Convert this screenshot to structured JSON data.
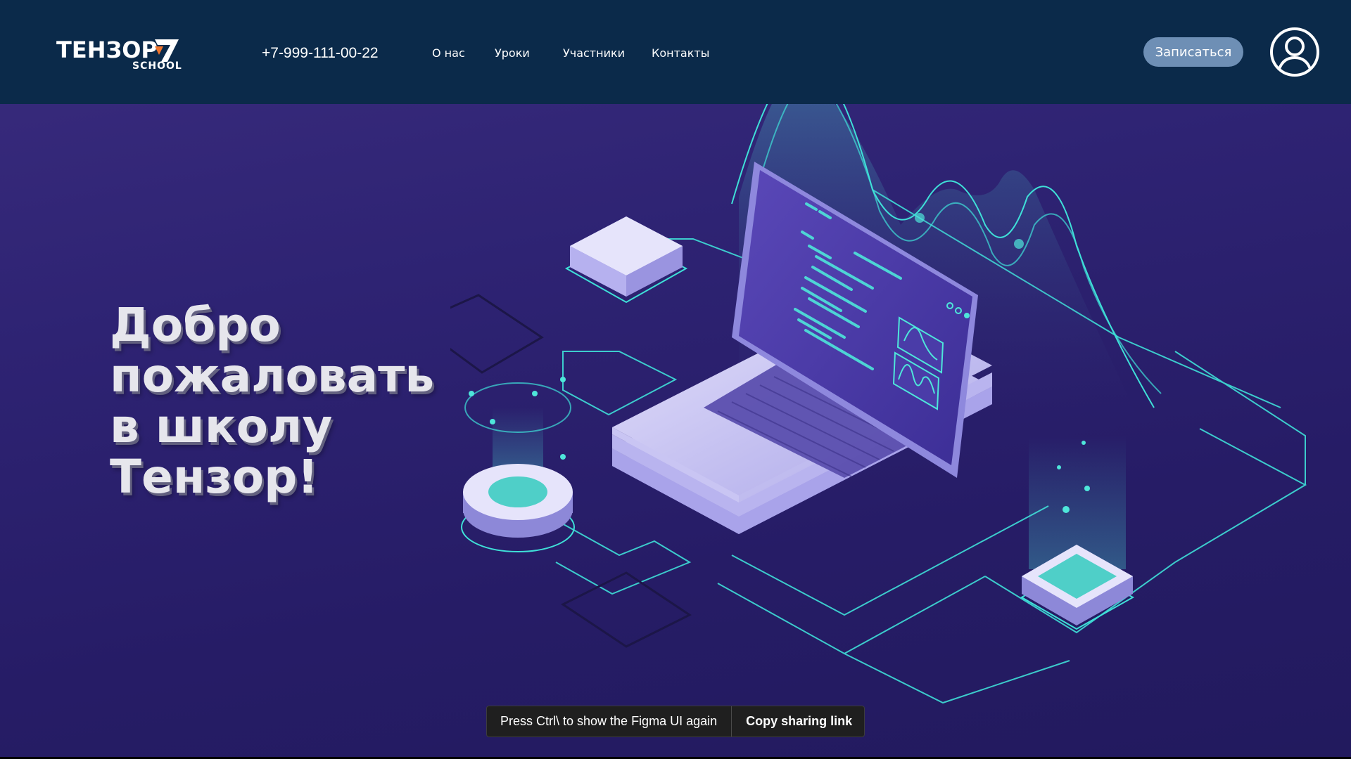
{
  "header": {
    "logo": {
      "word": "ТЕНЗОР",
      "sub": "SCHOOL"
    },
    "phone": "+7-999-111-00-22",
    "nav": [
      {
        "label": "О нас"
      },
      {
        "label": "Уроки"
      },
      {
        "label": "Участники"
      },
      {
        "label": "Контакты"
      }
    ],
    "signup_label": "Записаться",
    "avatar_icon": "user-avatar-icon"
  },
  "hero": {
    "headline_lines": [
      "Добро",
      "пожаловать",
      "в школу",
      "Тензор!"
    ]
  },
  "illustration": {
    "subject": "isometric-laptop-with-charts",
    "code_lines": [
      "---",
      "--",
      "- ------ --",
      "- -- ------ ---",
      "--- ----- - ---",
      "-- --- ---- --",
      "- ------ ---"
    ]
  },
  "figma_bar": {
    "message": "Press Ctrl\\ to show the Figma UI again",
    "copy_label": "Copy sharing link"
  },
  "colors": {
    "header_bg": "#0b2a4a",
    "hero_bg": "#2e2373",
    "accent_cyan": "#3fe0d8",
    "button_bg": "#6e8fb5",
    "laptop_body": "#c9c6f2"
  }
}
